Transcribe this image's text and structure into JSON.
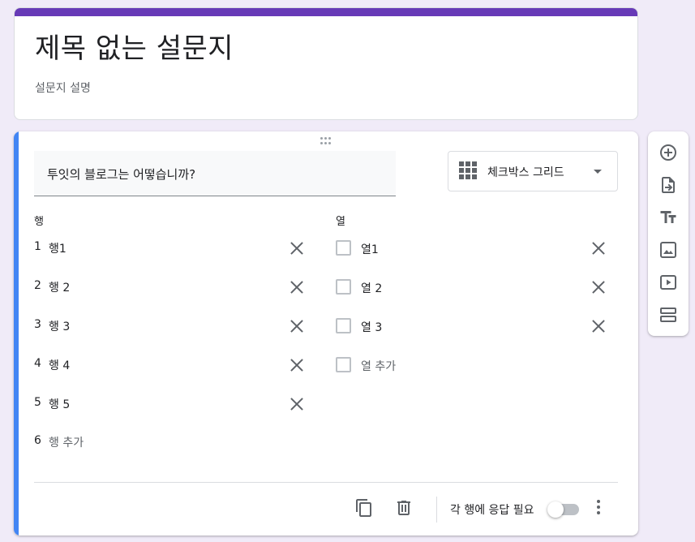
{
  "colors": {
    "page_background": "#f0ebf8",
    "theme_purple": "#673ab7",
    "active_accent_blue": "#4285f4",
    "icon_gray": "#5f6368"
  },
  "form": {
    "title": "제목 없는 설문지",
    "description": "설문지 설명"
  },
  "question": {
    "title": "투잇의 블로그는 어떻습니까?",
    "type_label": "체크박스 그리드",
    "type_icon": "grid-icon",
    "rows_header": "행",
    "columns_header": "열",
    "rows": [
      {
        "num": "1",
        "label": "행1"
      },
      {
        "num": "2",
        "label": "행 2"
      },
      {
        "num": "3",
        "label": "행 3"
      },
      {
        "num": "4",
        "label": "행 4"
      },
      {
        "num": "5",
        "label": "행 5"
      }
    ],
    "add_row": {
      "num": "6",
      "label": "행 추가"
    },
    "columns": [
      {
        "label": "열1"
      },
      {
        "label": "열 2"
      },
      {
        "label": "열 3"
      }
    ],
    "add_column": {
      "label": "열 추가"
    },
    "footer": {
      "duplicate_icon": "copy-icon",
      "delete_icon": "trash-icon",
      "required_label": "각 행에 응답 필요",
      "required_on": false,
      "more_icon": "more-vert-icon"
    }
  },
  "side_toolbar": {
    "items": [
      {
        "icon": "add-circle-icon"
      },
      {
        "icon": "import-question-icon"
      },
      {
        "icon": "title-text-icon"
      },
      {
        "icon": "image-icon"
      },
      {
        "icon": "video-icon"
      },
      {
        "icon": "section-icon"
      }
    ]
  }
}
